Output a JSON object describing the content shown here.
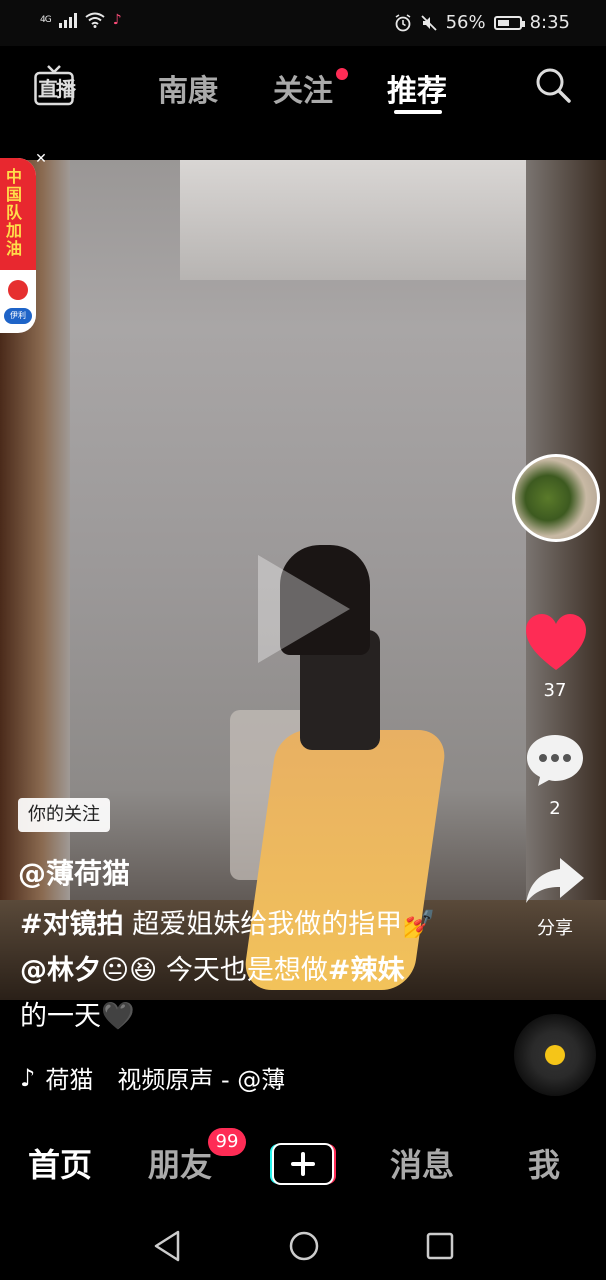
{
  "status_bar": {
    "network": "4G",
    "battery": "56%",
    "battery_level": 0.56,
    "time": "8:35"
  },
  "top_nav": {
    "live": "直播",
    "tabs": [
      {
        "label": "南康",
        "active": false
      },
      {
        "label": "关注",
        "active": false,
        "has_dot": true
      },
      {
        "label": "推荐",
        "active": true
      }
    ]
  },
  "ad_badge": {
    "text": "中国队加油",
    "brand": "伊利"
  },
  "video": {
    "follow_tag": "你的关注",
    "author": "@薄荷猫",
    "caption": {
      "hashtag1": "#对镜拍",
      "text1": "超爱姐妹给我做的指甲💅",
      "mention": "@林夕",
      "emoji1": "😐😆",
      "text2": "今天也是想做",
      "hashtag2": "#辣妹",
      "text3": "的一天🖤"
    },
    "music": {
      "title": "荷猫",
      "source": "视频原声 - @薄"
    }
  },
  "right_rail": {
    "likes": "37",
    "comments": "2",
    "share_label": "分享"
  },
  "bottom_nav": {
    "items": [
      {
        "label": "首页",
        "active": true
      },
      {
        "label": "朋友",
        "active": false,
        "badge": "99"
      },
      {
        "label": "",
        "active": false
      },
      {
        "label": "消息",
        "active": false
      },
      {
        "label": "我",
        "active": false
      }
    ]
  },
  "colors": {
    "accent": "#fe2c55",
    "disc_core": "#f5c518"
  }
}
